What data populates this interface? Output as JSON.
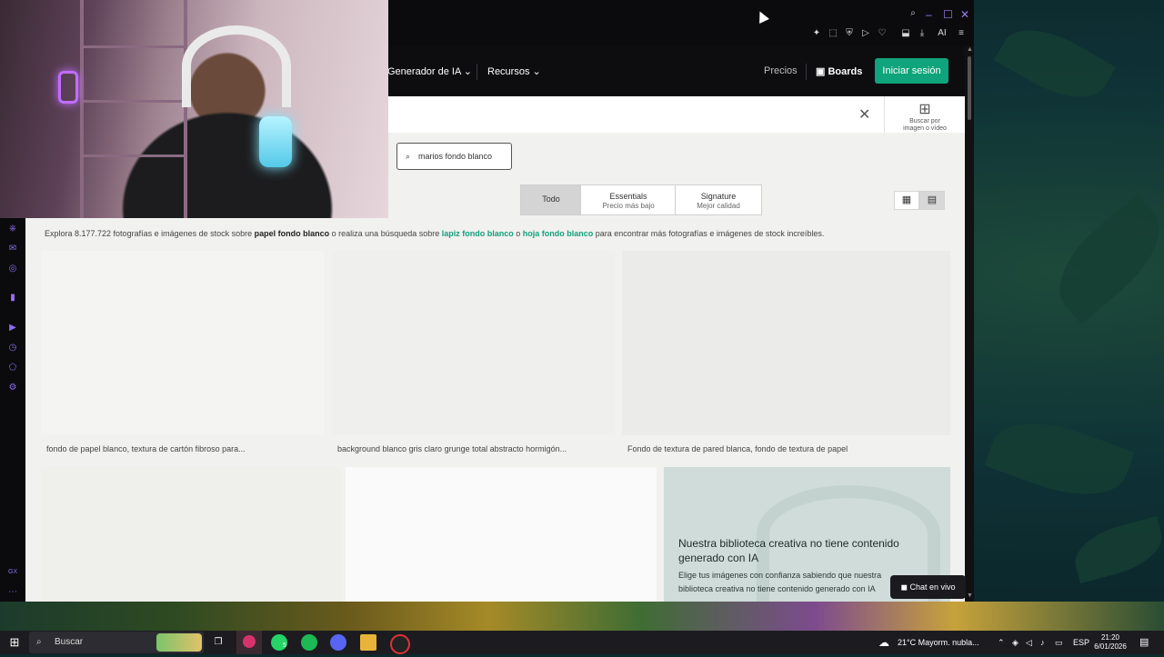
{
  "browser": {
    "toolbar_icons": [
      "pin-icon",
      "screenshot-icon",
      "shield-icon",
      "play-icon",
      "heart-icon",
      "box-icon",
      "download-icon",
      "ai-icon",
      "menu-icon"
    ],
    "ai_label": "AI"
  },
  "sidebar_icons": [
    "aria-icon",
    "chat-icon",
    "instagram-icon",
    "twitch-icon",
    "player-icon",
    "history-icon",
    "extensions-icon",
    "settings-icon",
    "gx-icon",
    "more-icon"
  ],
  "sidebar_gx": "GX",
  "header": {
    "nav": [
      {
        "label": "Generador de IA"
      },
      {
        "label": "Recursos"
      }
    ],
    "pricing": "Precios",
    "boards": "Boards",
    "login": "Iniciar sesión"
  },
  "search_band": {
    "image_search_line1": "Buscar por",
    "image_search_line2": "imagen o vídeo"
  },
  "content": {
    "query": "marios fondo blanco",
    "segments": [
      {
        "label": "Todo",
        "sub": ""
      },
      {
        "label": "Essentials",
        "sub": "Precio más bajo"
      },
      {
        "label": "Signature",
        "sub": "Mejor calidad"
      }
    ],
    "desc": {
      "pre": "Explora 8.177.722 fotografías e imágenes de stock sobre ",
      "term": "papel fondo blanco",
      "mid1": " o realiza una búsqueda sobre ",
      "link1": "lapiz fondo blanco",
      "mid2": " o ",
      "link2": "hoja fondo blanco",
      "post": " para encontrar más fotografías e imágenes de stock increíbles."
    },
    "captions": [
      "fondo de papel blanco, textura de cartón fibroso para...",
      "background blanco gris claro grunge total abstracto hormigón...",
      "Fondo de textura de pared blanca, fondo de textura de papel"
    ],
    "ai_card": {
      "title": "Nuestra biblioteca creativa no tiene contenido generado con IA",
      "text": "Elige tus imágenes con confianza sabiendo que nuestra biblioteca creativa no tiene contenido generado con IA"
    },
    "chat": "Chat en vivo"
  },
  "taskbar": {
    "search": "Buscar",
    "whatsapp_badge": "5",
    "weather": "21°C  Mayorm. nubla...",
    "lang": "ESP",
    "time": "21:20",
    "date": "6/01/2026"
  },
  "colors": {
    "accent": "#0fa47b",
    "opera_purple": "#9b7ef0"
  }
}
